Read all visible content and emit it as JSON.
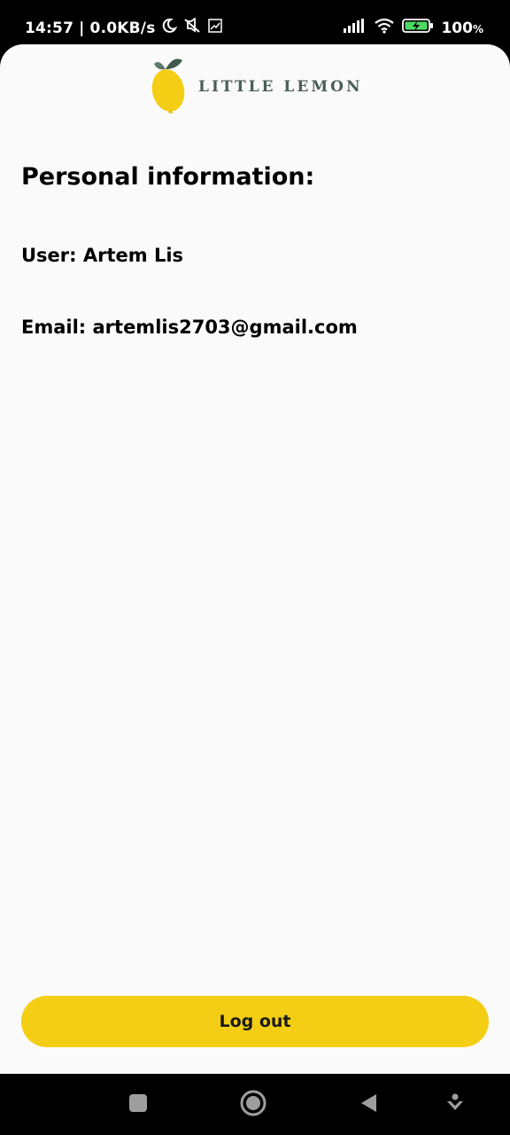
{
  "status_bar": {
    "time": "14:57",
    "separator": "|",
    "network_speed": "0.0KB/s",
    "battery": "100",
    "battery_unit": "%",
    "icons_left": [
      "moon-icon",
      "mute-icon",
      "trend-icon"
    ],
    "icons_right": [
      "signal-icon",
      "wifi-icon",
      "battery-charging-icon"
    ]
  },
  "header": {
    "logo_text": "LITTLE LEMON",
    "logo_icon": "lemon-icon"
  },
  "profile": {
    "heading": "Personal information:",
    "user_line": "User: Artem Lis",
    "email_line": "Email: artemlis2703@gmail.com"
  },
  "actions": {
    "logout_label": "Log out"
  },
  "nav_bar": {
    "buttons": [
      "recents-button",
      "home-button",
      "back-button",
      "assistant-button"
    ]
  },
  "colors": {
    "accent": "#f4ce14",
    "logo_text": "#4a5e57",
    "background": "#fafafa"
  }
}
